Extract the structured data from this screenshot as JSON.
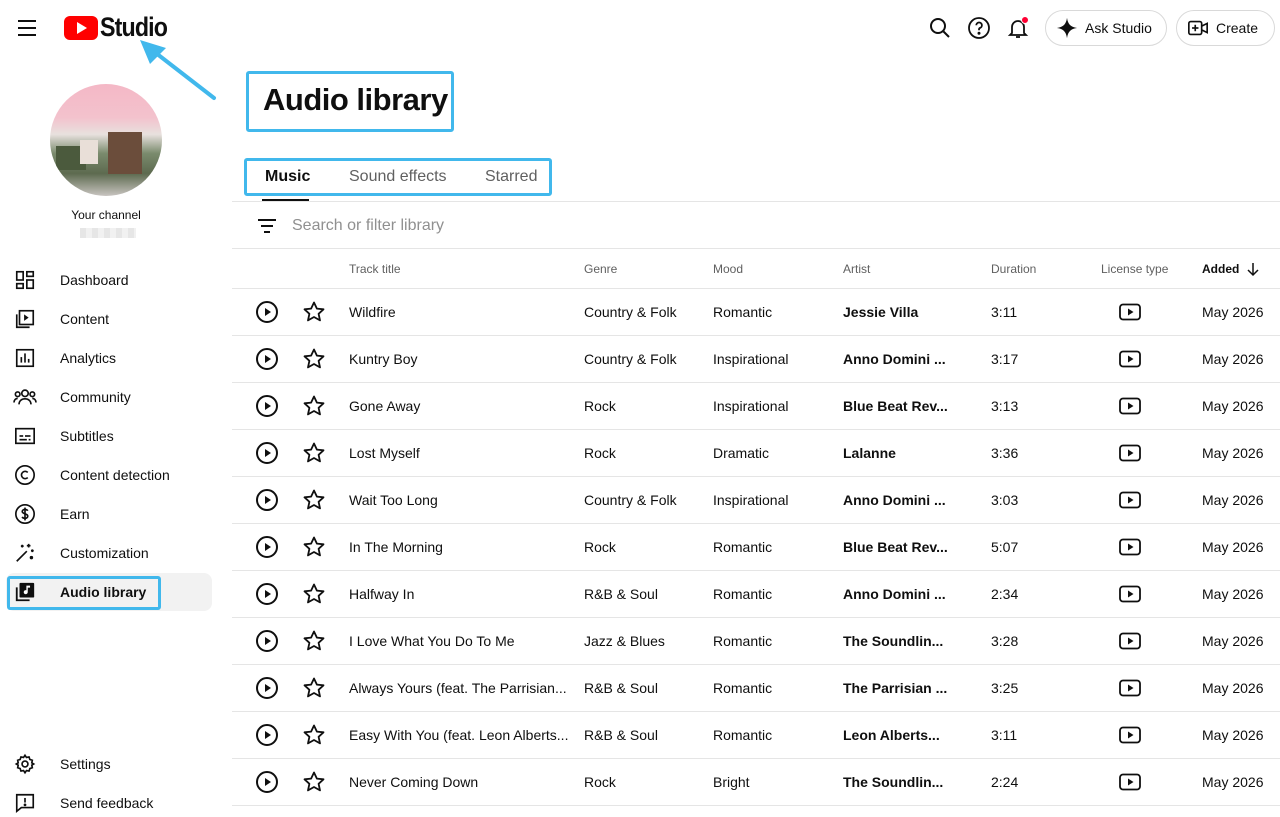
{
  "header": {
    "logo_text": "Studio",
    "ask_studio_label": "Ask Studio",
    "create_label": "Create",
    "colors": {
      "brand_red": "#ff0000",
      "notification_dot": "#ff0033",
      "annotation_blue": "#41b8ec"
    }
  },
  "sidebar": {
    "channel_label": "Your channel",
    "items": [
      {
        "label": "Dashboard",
        "icon": "dashboard-icon"
      },
      {
        "label": "Content",
        "icon": "content-icon"
      },
      {
        "label": "Analytics",
        "icon": "analytics-icon"
      },
      {
        "label": "Community",
        "icon": "community-icon"
      },
      {
        "label": "Subtitles",
        "icon": "subtitles-icon"
      },
      {
        "label": "Content detection",
        "icon": "copyright-icon"
      },
      {
        "label": "Earn",
        "icon": "dollar-icon"
      },
      {
        "label": "Customization",
        "icon": "magic-wand-icon"
      },
      {
        "label": "Audio library",
        "icon": "audio-library-icon",
        "active": true
      }
    ],
    "bottom_items": [
      {
        "label": "Settings",
        "icon": "gear-icon"
      },
      {
        "label": "Send feedback",
        "icon": "feedback-icon"
      }
    ]
  },
  "main": {
    "title": "Audio library",
    "tabs": [
      {
        "label": "Music",
        "active": true
      },
      {
        "label": "Sound effects"
      },
      {
        "label": "Starred"
      }
    ],
    "search": {
      "placeholder": "Search or filter library",
      "value": ""
    },
    "columns": {
      "track_title": "Track title",
      "genre": "Genre",
      "mood": "Mood",
      "artist": "Artist",
      "duration": "Duration",
      "license_type": "License type",
      "added": "Added"
    },
    "rows": [
      {
        "title": "Wildfire",
        "genre": "Country & Folk",
        "mood": "Romantic",
        "artist": "Jessie Villa",
        "duration": "3:11",
        "added": "May 2026"
      },
      {
        "title": "Kuntry Boy",
        "genre": "Country & Folk",
        "mood": "Inspirational",
        "artist": "Anno Domini ...",
        "duration": "3:17",
        "added": "May 2026"
      },
      {
        "title": "Gone Away",
        "genre": "Rock",
        "mood": "Inspirational",
        "artist": "Blue Beat Rev...",
        "duration": "3:13",
        "added": "May 2026"
      },
      {
        "title": "Lost Myself",
        "genre": "Rock",
        "mood": "Dramatic",
        "artist": "Lalanne",
        "duration": "3:36",
        "added": "May 2026"
      },
      {
        "title": "Wait Too Long",
        "genre": "Country & Folk",
        "mood": "Inspirational",
        "artist": "Anno Domini ...",
        "duration": "3:03",
        "added": "May 2026"
      },
      {
        "title": "In The Morning",
        "genre": "Rock",
        "mood": "Romantic",
        "artist": "Blue Beat Rev...",
        "duration": "5:07",
        "added": "May 2026"
      },
      {
        "title": "Halfway In",
        "genre": "R&B & Soul",
        "mood": "Romantic",
        "artist": "Anno Domini ...",
        "duration": "2:34",
        "added": "May 2026"
      },
      {
        "title": "I Love What You Do To Me",
        "genre": "Jazz & Blues",
        "mood": "Romantic",
        "artist": "The Soundlin...",
        "duration": "3:28",
        "added": "May 2026"
      },
      {
        "title": "Always Yours (feat. The Parrisian...",
        "genre": "R&B & Soul",
        "mood": "Romantic",
        "artist": "The Parrisian ...",
        "duration": "3:25",
        "added": "May 2026"
      },
      {
        "title": "Easy With You (feat. Leon Alberts...",
        "genre": "R&B & Soul",
        "mood": "Romantic",
        "artist": "Leon Alberts...",
        "duration": "3:11",
        "added": "May 2026"
      },
      {
        "title": "Never Coming Down",
        "genre": "Rock",
        "mood": "Bright",
        "artist": "The Soundlin...",
        "duration": "2:24",
        "added": "May 2026"
      }
    ]
  }
}
